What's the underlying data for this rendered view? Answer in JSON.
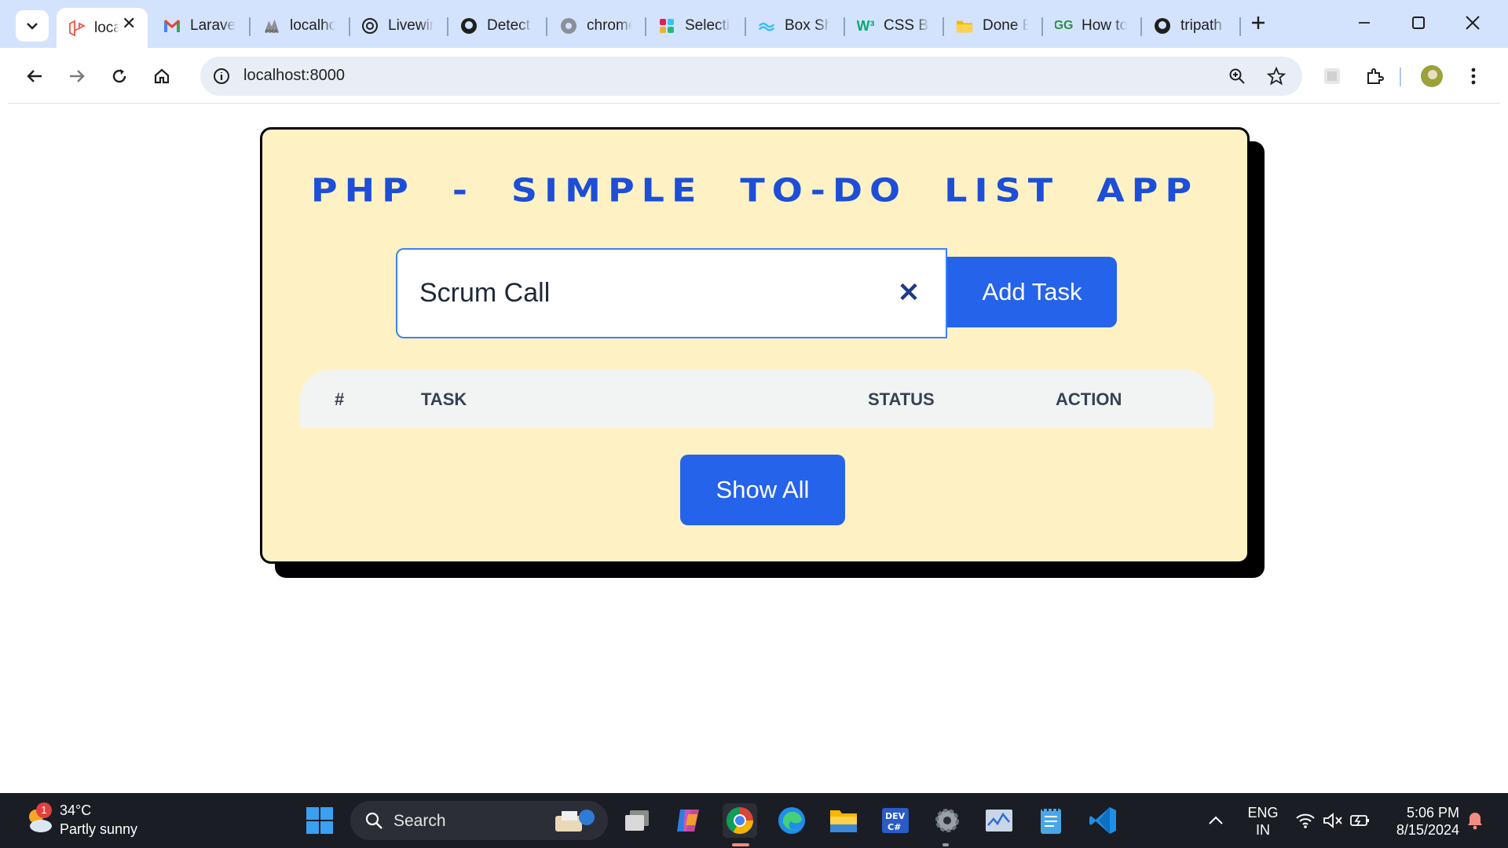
{
  "browser": {
    "tabs": [
      {
        "label": "localhost",
        "favicon": "laravel-icon",
        "active": true
      },
      {
        "label": "Laravel",
        "favicon": "gmail-icon"
      },
      {
        "label": "localhost",
        "favicon": "phpmyadmin-icon"
      },
      {
        "label": "Livewire",
        "favicon": "openai-icon"
      },
      {
        "label": "Detect",
        "favicon": "github-icon"
      },
      {
        "label": "chrome",
        "favicon": "globe-icon"
      },
      {
        "label": "Selection",
        "favicon": "slack-icon"
      },
      {
        "label": "Box Shadow",
        "favicon": "tailwind-icon"
      },
      {
        "label": "CSS Box",
        "favicon": "w3schools-icon"
      },
      {
        "label": "Done E",
        "favicon": "folder-icon"
      },
      {
        "label": "How to",
        "favicon": "geeksforgeeks-icon"
      },
      {
        "label": "tripath",
        "favicon": "github-icon"
      }
    ],
    "url": "localhost:8000"
  },
  "app": {
    "title": "PHP - SIMPLE TO-DO LIST APP",
    "task_input_value": "Scrum Call",
    "add_button": "Add Task",
    "clear_symbol": "✕",
    "table_headers": {
      "num": "#",
      "task": "TASK",
      "status": "STATUS",
      "action": "ACTION"
    },
    "show_all_button": "Show All"
  },
  "taskbar": {
    "weather_temp": "34°C",
    "weather_condition": "Partly sunny",
    "weather_badge": "1",
    "search_label": "Search",
    "lang_top": "ENG",
    "lang_bottom": "IN",
    "time": "5:06 PM",
    "date": "8/15/2024"
  },
  "colors": {
    "accent": "#2563eb",
    "title": "#1d4ed8",
    "card_bg": "#fef2c5",
    "tabbar_bg": "#d3e3fd"
  }
}
